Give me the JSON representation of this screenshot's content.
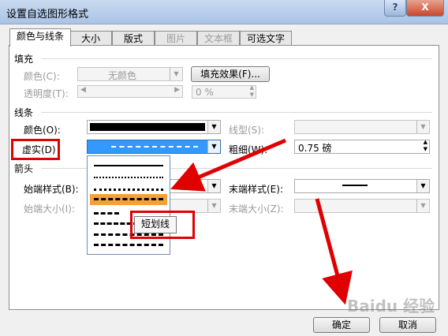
{
  "window": {
    "title": "设置自选图形格式",
    "help_label": "?",
    "close_label": "X"
  },
  "tabs": [
    {
      "label": "颜色与线条"
    },
    {
      "label": "大小"
    },
    {
      "label": "版式"
    },
    {
      "label": "图片"
    },
    {
      "label": "文本框"
    },
    {
      "label": "可选文字"
    }
  ],
  "fill": {
    "section_label": "填充",
    "color_label": "颜色(C):",
    "color_value": "无颜色",
    "effects_button": "填充效果(F)...",
    "transparency_label": "透明度(T):",
    "transparency_value": "0 %"
  },
  "line": {
    "section_label": "线条",
    "color_label": "颜色(O):",
    "dash_label": "虚实(D)",
    "style_label": "线型(S):",
    "weight_label": "粗细(W):",
    "weight_value": "0.75 磅"
  },
  "arrows": {
    "section_label": "箭头",
    "begin_style_label": "始端样式(B):",
    "begin_size_label": "始端大小(I):",
    "end_style_label": "末端样式(E):",
    "end_size_label": "末端大小(Z):"
  },
  "dropdown": {
    "tooltip": "短划线",
    "selected_index": 2
  },
  "buttons": {
    "ok": "确定",
    "cancel": "取消"
  },
  "colors": {
    "highlight": "#f7a035",
    "selected_combo": "#3399ff",
    "annotation": "#e00000"
  },
  "watermark": "Baidu 经验"
}
